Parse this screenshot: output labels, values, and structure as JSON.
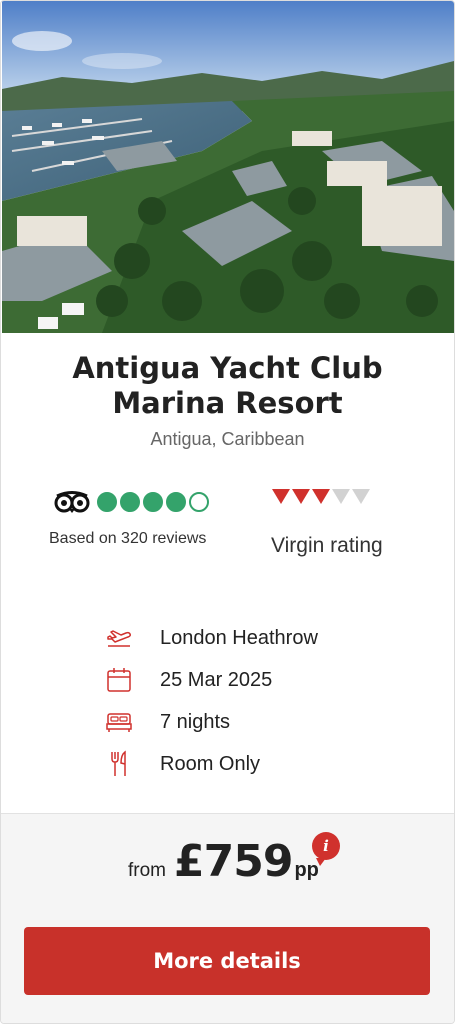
{
  "hotel": {
    "name_line1": "Antigua Yacht Club",
    "name_line2": "Marina Resort",
    "location": "Antigua, Caribbean"
  },
  "tripadvisor": {
    "icon": "tripadvisor-owl-icon",
    "rating_bubbles": 4,
    "max_bubbles": 5,
    "reviews_text": "Based on 320 reviews",
    "color": "#34a36b"
  },
  "virgin_rating": {
    "rating": 3,
    "max": 5,
    "label": "Virgin rating",
    "color": "#d0312d"
  },
  "details": [
    {
      "icon": "plane-departure-icon",
      "text": "London Heathrow"
    },
    {
      "icon": "calendar-icon",
      "text": "25 Mar 2025"
    },
    {
      "icon": "bed-icon",
      "text": "7 nights"
    },
    {
      "icon": "cutlery-icon",
      "text": "Room Only"
    }
  ],
  "price": {
    "prefix": "from",
    "amount": "£759",
    "suffix": "pp",
    "info_icon": "info-icon",
    "info_glyph": "i"
  },
  "cta": {
    "label": "More details",
    "color": "#c8312a"
  }
}
